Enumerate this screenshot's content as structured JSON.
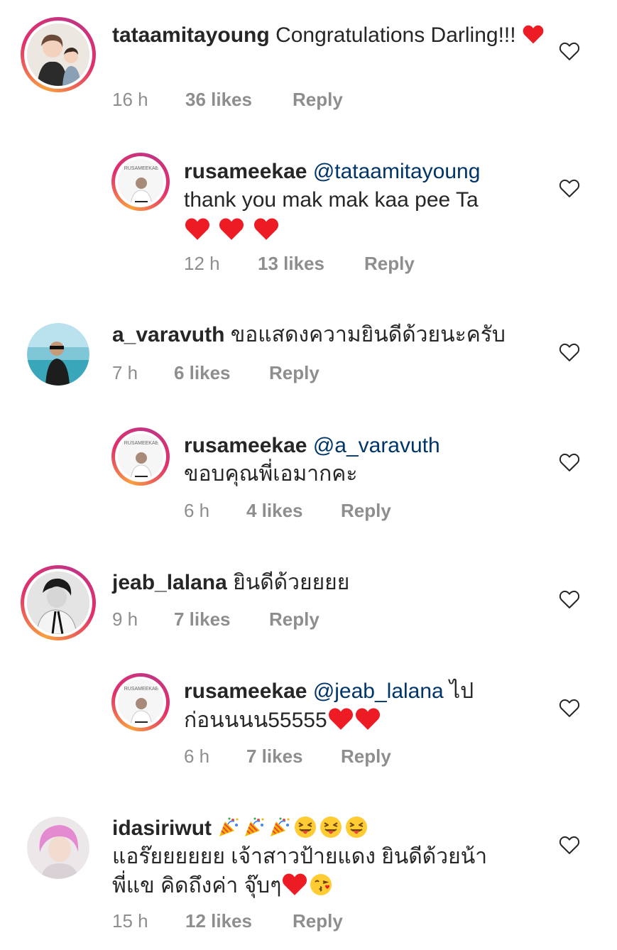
{
  "comments": [
    {
      "user": "tataamitayoung",
      "text": "Congratulations Darling!!!",
      "time": "16 h",
      "likes": "36 likes",
      "reply": "Reply"
    },
    {
      "user": "rusameekae",
      "mention": "@tataamitayoung",
      "text": "thank you mak mak kaa pee Ta",
      "time": "12 h",
      "likes": "13 likes",
      "reply": "Reply"
    },
    {
      "user": "a_varavuth",
      "text": "ขอแสดงความยินดีด้วยนะครับ",
      "time": "7 h",
      "likes": "6 likes",
      "reply": "Reply"
    },
    {
      "user": "rusameekae",
      "mention": "@a_varavuth",
      "text": "ขอบคุณพี่เอมากคะ",
      "time": "6 h",
      "likes": "4 likes",
      "reply": "Reply"
    },
    {
      "user": "jeab_lalana",
      "text": "ยินดีด้วยยยย",
      "time": "9 h",
      "likes": "7 likes",
      "reply": "Reply"
    },
    {
      "user": "rusameekae",
      "mention": "@jeab_lalana",
      "text_line1": "ไป",
      "text_line2": "ก่อนนนน55555",
      "time": "6 h",
      "likes": "7 likes",
      "reply": "Reply"
    },
    {
      "user": "idasiriwut",
      "text_line2": "แอร๊ยยยยยย เจ้าสาวป้ายแดง ยินดีด้วยน้า",
      "text_line3": "พี่แข คิดถึงค่า จุ๊บๆ",
      "time": "15 h",
      "likes": "12 likes",
      "reply": "Reply"
    }
  ],
  "avatar_labels": {
    "rusameekae": "RUSAMEEKAE"
  },
  "colors": {
    "heart": "#ed1c24",
    "mention": "#003569",
    "meta": "#8e8e8e",
    "text": "#262626"
  }
}
